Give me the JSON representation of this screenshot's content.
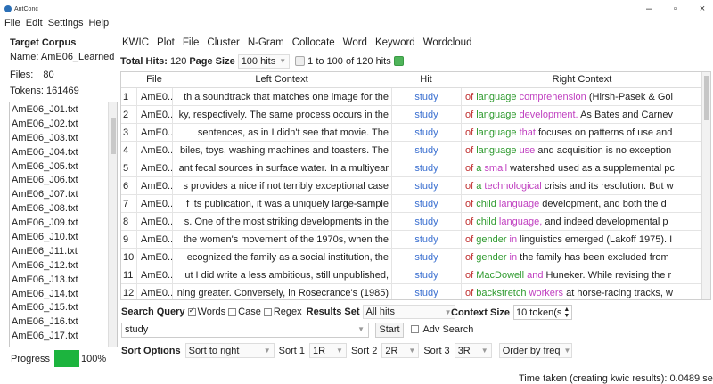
{
  "window": {
    "title": "AntConc",
    "controls": {
      "minimize": "–",
      "maximize": "▫",
      "close": "×"
    }
  },
  "menu": [
    "File",
    "Edit",
    "Settings",
    "Help"
  ],
  "left": {
    "heading": "Target Corpus",
    "name_label": "Name:",
    "name_value": "AmE06_Learned",
    "files_label": "Files:",
    "files_value": "80",
    "tokens_label": "Tokens:",
    "tokens_value": "161469",
    "files": [
      "AmE06_J01.txt",
      "AmE06_J02.txt",
      "AmE06_J03.txt",
      "AmE06_J04.txt",
      "AmE06_J05.txt",
      "AmE06_J06.txt",
      "AmE06_J07.txt",
      "AmE06_J08.txt",
      "AmE06_J09.txt",
      "AmE06_J10.txt",
      "AmE06_J11.txt",
      "AmE06_J12.txt",
      "AmE06_J13.txt",
      "AmE06_J14.txt",
      "AmE06_J15.txt",
      "AmE06_J16.txt",
      "AmE06_J17.txt"
    ],
    "progress_label": "Progress",
    "progress_value": "100%",
    "progress_fraction": 1.0,
    "progress_color": "#1cb43e"
  },
  "tabs": [
    "KWIC",
    "Plot",
    "File",
    "Cluster",
    "N-Gram",
    "Collocate",
    "Word",
    "Keyword",
    "Wordcloud"
  ],
  "toolbar": {
    "total_hits_label": "Total Hits:",
    "total_hits_value": "120",
    "page_size_label": "Page Size",
    "page_size_value": "100 hits",
    "range_text": "1 to 100 of 120 hits"
  },
  "table": {
    "columns": [
      "File",
      "Left Context",
      "Hit",
      "Right Context"
    ],
    "rows": [
      {
        "n": "1",
        "file": "AmE0...",
        "left": "th a soundtrack that matches one image for the",
        "hit": "study",
        "right": [
          [
            "of ",
            "#c03030"
          ],
          [
            "language ",
            "#2e9a2e"
          ],
          [
            "comprehension ",
            "#c040c0"
          ],
          [
            "(Hirsh-Pasek & Gol",
            "#222222"
          ]
        ]
      },
      {
        "n": "2",
        "file": "AmE0...",
        "left": "ky, respectively. The same process occurs in the",
        "hit": "study",
        "right": [
          [
            "of ",
            "#c03030"
          ],
          [
            "language ",
            "#2e9a2e"
          ],
          [
            "development. ",
            "#c040c0"
          ],
          [
            "As Bates and Carnev",
            "#222222"
          ]
        ]
      },
      {
        "n": "3",
        "file": "AmE0...",
        "left": "sentences, as in I didn't see that movie. The",
        "hit": "study",
        "right": [
          [
            "of ",
            "#c03030"
          ],
          [
            "language ",
            "#2e9a2e"
          ],
          [
            "that ",
            "#c040c0"
          ],
          [
            "focuses on patterns of use and",
            "#222222"
          ]
        ]
      },
      {
        "n": "4",
        "file": "AmE0...",
        "left": "biles, toys, washing machines and toasters. The",
        "hit": "study",
        "right": [
          [
            "of ",
            "#c03030"
          ],
          [
            "language ",
            "#2e9a2e"
          ],
          [
            "use ",
            "#c040c0"
          ],
          [
            "and acquisition is no exception",
            "#222222"
          ]
        ]
      },
      {
        "n": "5",
        "file": "AmE0...",
        "left": "ant fecal sources in surface water. In a multiyear",
        "hit": "study",
        "right": [
          [
            "of ",
            "#c03030"
          ],
          [
            "a ",
            "#2e9a2e"
          ],
          [
            "small ",
            "#c040c0"
          ],
          [
            "watershed used as a supplemental pc",
            "#222222"
          ]
        ]
      },
      {
        "n": "6",
        "file": "AmE0...",
        "left": "s provides a nice if not terribly exceptional case",
        "hit": "study",
        "right": [
          [
            "of ",
            "#c03030"
          ],
          [
            "a ",
            "#2e9a2e"
          ],
          [
            "technological ",
            "#c040c0"
          ],
          [
            "crisis and its resolution. But w",
            "#222222"
          ]
        ]
      },
      {
        "n": "7",
        "file": "AmE0...",
        "left": "f its publication, it was a uniquely large-sample",
        "hit": "study",
        "right": [
          [
            "of ",
            "#c03030"
          ],
          [
            "child ",
            "#2e9a2e"
          ],
          [
            "language ",
            "#c040c0"
          ],
          [
            "development, and both the d",
            "#222222"
          ]
        ]
      },
      {
        "n": "8",
        "file": "AmE0...",
        "left": "s. One of the most striking developments in the",
        "hit": "study",
        "right": [
          [
            "of ",
            "#c03030"
          ],
          [
            "child ",
            "#2e9a2e"
          ],
          [
            "language, ",
            "#c040c0"
          ],
          [
            "and indeed developmental p",
            "#222222"
          ]
        ]
      },
      {
        "n": "9",
        "file": "AmE0...",
        "left": "the women's movement of the 1970s, when the",
        "hit": "study",
        "right": [
          [
            "of ",
            "#c03030"
          ],
          [
            "gender ",
            "#2e9a2e"
          ],
          [
            "in ",
            "#c040c0"
          ],
          [
            "linguistics emerged (Lakoff 1975). I",
            "#222222"
          ]
        ]
      },
      {
        "n": "10",
        "file": "AmE0...",
        "left": "ecognized the family as a social institution, the",
        "hit": "study",
        "right": [
          [
            "of ",
            "#c03030"
          ],
          [
            "gender ",
            "#2e9a2e"
          ],
          [
            "in ",
            "#c040c0"
          ],
          [
            "the family has been excluded from",
            "#222222"
          ]
        ]
      },
      {
        "n": "11",
        "file": "AmE0...",
        "left": "ut I did write a less ambitious, still unpublished,",
        "hit": "study",
        "right": [
          [
            "of ",
            "#c03030"
          ],
          [
            "MacDowell ",
            "#2e9a2e"
          ],
          [
            "and ",
            "#c040c0"
          ],
          [
            "Huneker. While revising the r",
            "#222222"
          ]
        ]
      },
      {
        "n": "12",
        "file": "AmE0...",
        "left": "ning greater. Conversely, in Rosecrance's (1985)",
        "hit": "study",
        "right": [
          [
            "of ",
            "#c03030"
          ],
          [
            "backstretch ",
            "#2e9a2e"
          ],
          [
            "workers ",
            "#c040c0"
          ],
          [
            "at horse-racing tracks, w",
            "#222222"
          ]
        ]
      }
    ]
  },
  "search": {
    "query_label": "Search Query",
    "words_label": "Words",
    "case_label": "Case",
    "regex_label": "Regex",
    "results_set_label": "Results Set",
    "results_set_value": "All hits",
    "context_size_label": "Context Size",
    "context_size_value": "10 token(s",
    "input_value": "study",
    "start_label": "Start",
    "adv_label": "Adv Search"
  },
  "sort": {
    "label": "Sort Options",
    "mode": "Sort to right",
    "sort1_label": "Sort 1",
    "sort1_value": "1R",
    "sort2_label": "Sort 2",
    "sort2_value": "2R",
    "sort3_label": "Sort 3",
    "sort3_value": "3R",
    "order": "Order by freq"
  },
  "status": {
    "time_taken": "Time taken (creating kwic results):  0.0489 se"
  }
}
